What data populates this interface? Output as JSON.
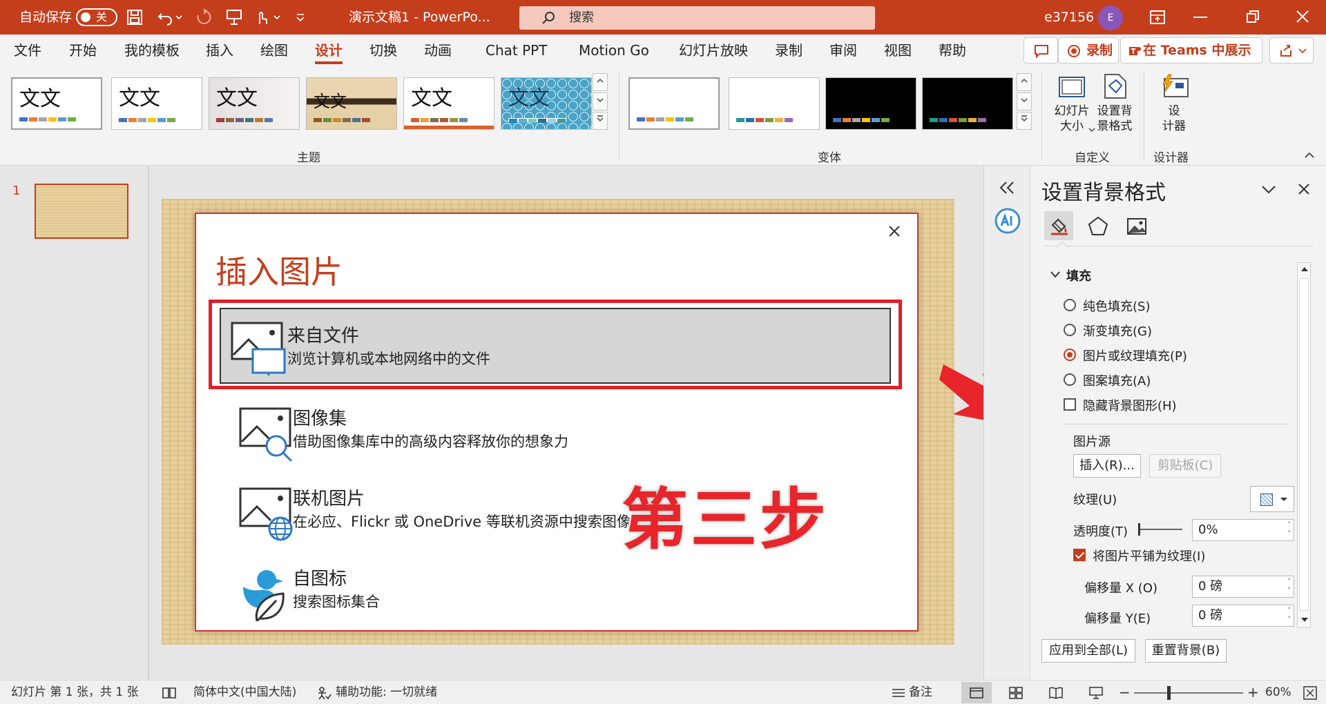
{
  "titlebar": {
    "autosave_label": "自动保存",
    "autosave_state": "关",
    "doc_title": "演示文稿1  -  PowerPo...",
    "search_placeholder": "搜索",
    "user_name": "e37156",
    "avatar_initial": "E"
  },
  "menu": {
    "tabs": [
      "文件",
      "开始",
      "我的模板",
      "插入",
      "绘图",
      "设计",
      "切换",
      "动画",
      "Chat PPT",
      "Motion Go",
      "幻灯片放映",
      "录制",
      "审阅",
      "视图",
      "帮助"
    ],
    "active_tab": "设计",
    "record_button": "录制",
    "teams_button": "在 Teams 中展示"
  },
  "ribbon": {
    "theme_sample_text": "文文",
    "themes_group_label": "主题",
    "variants_group_label": "变体",
    "slide_size_label": "幻灯片\n大小",
    "format_bg_label": "设置背\n景格式",
    "customize_group_label": "自定义",
    "designer_label": "设\n计器",
    "designer_group_label": "设计器"
  },
  "thumbs": {
    "slide_number": "1"
  },
  "dialog": {
    "title": "插入图片",
    "options": [
      {
        "title": "来自文件",
        "desc": "浏览计算机或本地网络中的文件"
      },
      {
        "title": "图像集",
        "desc": "借助图像集库中的高级内容释放你的想象力"
      },
      {
        "title": "联机图片",
        "desc": "在必应、Flickr 或 OneDrive 等联机资源中搜索图像"
      },
      {
        "title": "自图标",
        "desc": "搜索图标集合"
      }
    ]
  },
  "annotation": {
    "step_text": "第三步",
    "accent": "#e8252a"
  },
  "pane": {
    "title": "设置背景格式",
    "fill_section": "填充",
    "radio_solid": "纯色填充(S)",
    "radio_gradient": "渐变填充(G)",
    "radio_picture": "图片或纹理填充(P)",
    "radio_pattern": "图案填充(A)",
    "hide_bg_graphics": "隐藏背景图形(H)",
    "picture_source": "图片源",
    "insert_button": "插入(R)...",
    "clipboard_button": "剪贴板(C)",
    "texture_label": "纹理(U)",
    "transparency_label": "透明度(T)",
    "transparency_value": "0%",
    "tile_label": "将图片平铺为纹理(I)",
    "offset_x_label": "偏移量 X (O)",
    "offset_x_value": "0 磅",
    "offset_y_label": "偏移量 Y(E)",
    "offset_y_value": "0 磅",
    "apply_all_button": "应用到全部(L)",
    "reset_button": "重置背景(B)"
  },
  "status": {
    "slide_info": "幻灯片 第 1 张，共 1 张",
    "language": "简体中文(中国大陆)",
    "accessibility": "辅助功能: 一切就绪",
    "notes": "备注",
    "zoom": "60%"
  },
  "colors": {
    "brand": "#c43e1c",
    "dialog_border": "#d13438"
  }
}
